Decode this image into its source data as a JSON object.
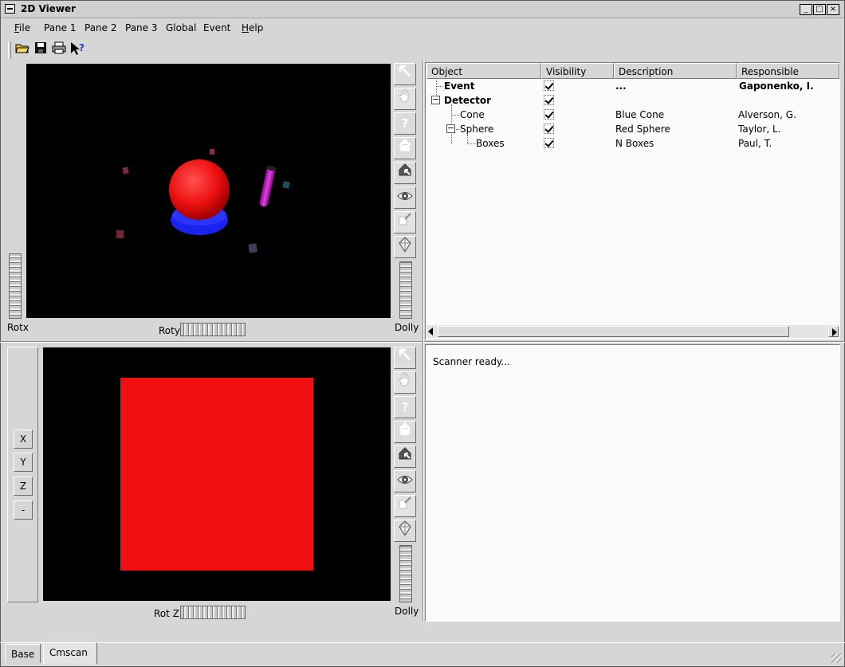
{
  "window": {
    "title": "2D Viewer"
  },
  "menu": [
    {
      "label": "File",
      "mnemonic": "F",
      "rest": "ile"
    },
    {
      "label": "Pane 1"
    },
    {
      "label": "Pane 2"
    },
    {
      "label": "Pane 3"
    },
    {
      "label": "Global"
    },
    {
      "label": "Event"
    },
    {
      "label": "Help",
      "mnemonic": "H",
      "rest": "elp"
    }
  ],
  "toolbar": {
    "icons": [
      "open-folder-icon",
      "save-disk-icon",
      "print-icon",
      "whats-this-icon"
    ]
  },
  "pane1": {
    "rotx_label": "Rotx",
    "roty_label": "Roty",
    "dolly_label": "Dolly",
    "tool_icons": [
      "arrow-select-icon",
      "hand-pan-icon",
      "help-question-icon",
      "home-icon",
      "set-home-icon",
      "view-all-eye-icon",
      "seek-icon",
      "projection-icon"
    ]
  },
  "pane2": {
    "axis_buttons": [
      "X",
      "Y",
      "Z",
      "-"
    ],
    "rotz_label": "Rot Z",
    "dolly_label": "Dolly"
  },
  "tree": {
    "columns": [
      "Object",
      "Visibility",
      "Description",
      "Responsible"
    ],
    "rows": [
      {
        "object": "Event",
        "visible": true,
        "description": "...",
        "responsible": "Gaponenko, I.",
        "bold": true
      },
      {
        "object": "Detector",
        "visible": true,
        "description": "",
        "responsible": "",
        "bold": true,
        "expander": "−"
      },
      {
        "object": "Cone",
        "visible": true,
        "description": "Blue Cone",
        "responsible": "Alverson, G."
      },
      {
        "object": "Sphere",
        "visible": true,
        "description": "Red Sphere",
        "responsible": "Taylor, L.",
        "expander": "−"
      },
      {
        "object": "Boxes",
        "visible": true,
        "description": "N Boxes",
        "responsible": "Paul, T."
      }
    ]
  },
  "console": {
    "text": "Scanner ready..."
  },
  "tabs": [
    "Base",
    "Cmscan"
  ],
  "colors": {
    "sphere": "#ee1111",
    "disc": "#1122ee",
    "cylinder": "#cc22cc",
    "square": "#f01010"
  }
}
